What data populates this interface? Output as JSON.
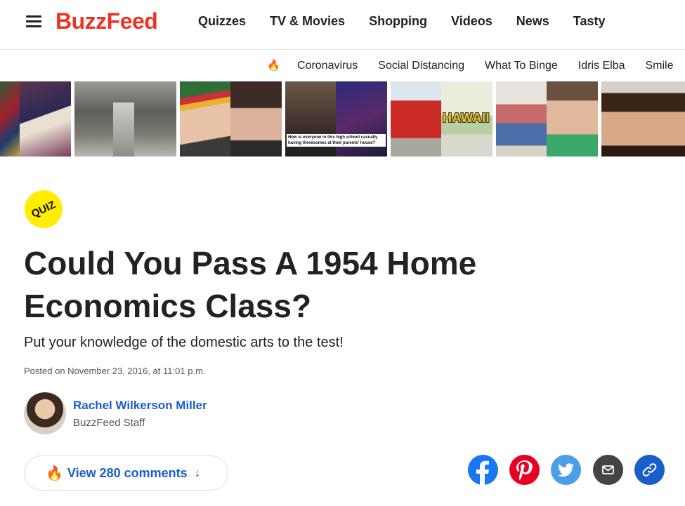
{
  "header": {
    "logo": "BuzzFeed",
    "nav": [
      "Quizzes",
      "TV & Movies",
      "Shopping",
      "Videos",
      "News",
      "Tasty"
    ]
  },
  "trending": {
    "items": [
      "Coronavirus",
      "Social Distancing",
      "What To Binge",
      "Idris Elba",
      "Smile"
    ]
  },
  "thumbnails": {
    "caption": "How is everyone in this high school casually having threesomes at their parents' house?",
    "overlay_text": "HAWAII"
  },
  "article": {
    "badge": "QUIZ",
    "title": "Could You Pass A 1954 Home Economics Class?",
    "subtitle": "Put your knowledge of the domestic arts to the test!",
    "posted": "Posted on November 23, 2016, at 11:01 p.m.",
    "author_name": "Rachel Wilkerson Miller",
    "author_role": "BuzzFeed Staff",
    "comments_label": "View 280 comments",
    "comments_arrow": "↓"
  },
  "share": [
    {
      "name": "facebook",
      "color": "#1877f2"
    },
    {
      "name": "pinterest",
      "color": "#e60023"
    },
    {
      "name": "twitter",
      "color": "#4a9fe8"
    },
    {
      "name": "email",
      "color": "#444444"
    },
    {
      "name": "copy-link",
      "color": "#1a5ec9"
    }
  ],
  "colors": {
    "brand": "#ee3322",
    "link": "#1a5ec9",
    "badge": "#ffee00"
  }
}
